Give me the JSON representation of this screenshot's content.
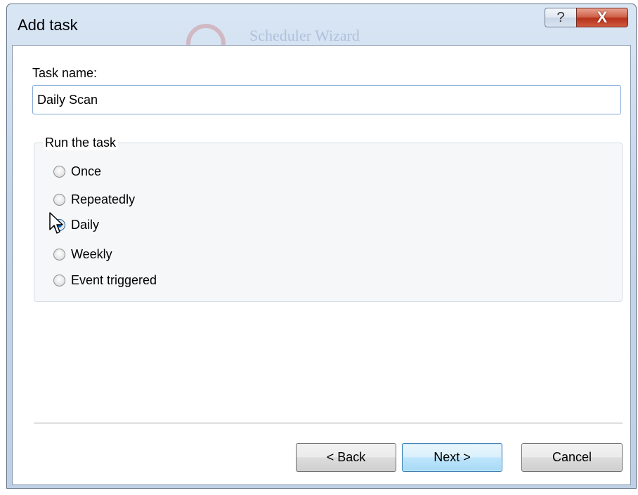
{
  "window": {
    "title": "Add task",
    "background_caption": "Scheduler Wizard",
    "help_symbol": "?",
    "close_symbol": "X"
  },
  "form": {
    "task_name_label": "Task name:",
    "task_name_value": "Daily Scan",
    "group_title": "Run the task",
    "options": [
      {
        "label": "Once",
        "checked": false
      },
      {
        "label": "Repeatedly",
        "checked": false
      },
      {
        "label": "Daily",
        "checked": true
      },
      {
        "label": "Weekly",
        "checked": false
      },
      {
        "label": "Event triggered",
        "checked": false
      }
    ]
  },
  "buttons": {
    "back": "< Back",
    "next": "Next >",
    "cancel": "Cancel"
  }
}
